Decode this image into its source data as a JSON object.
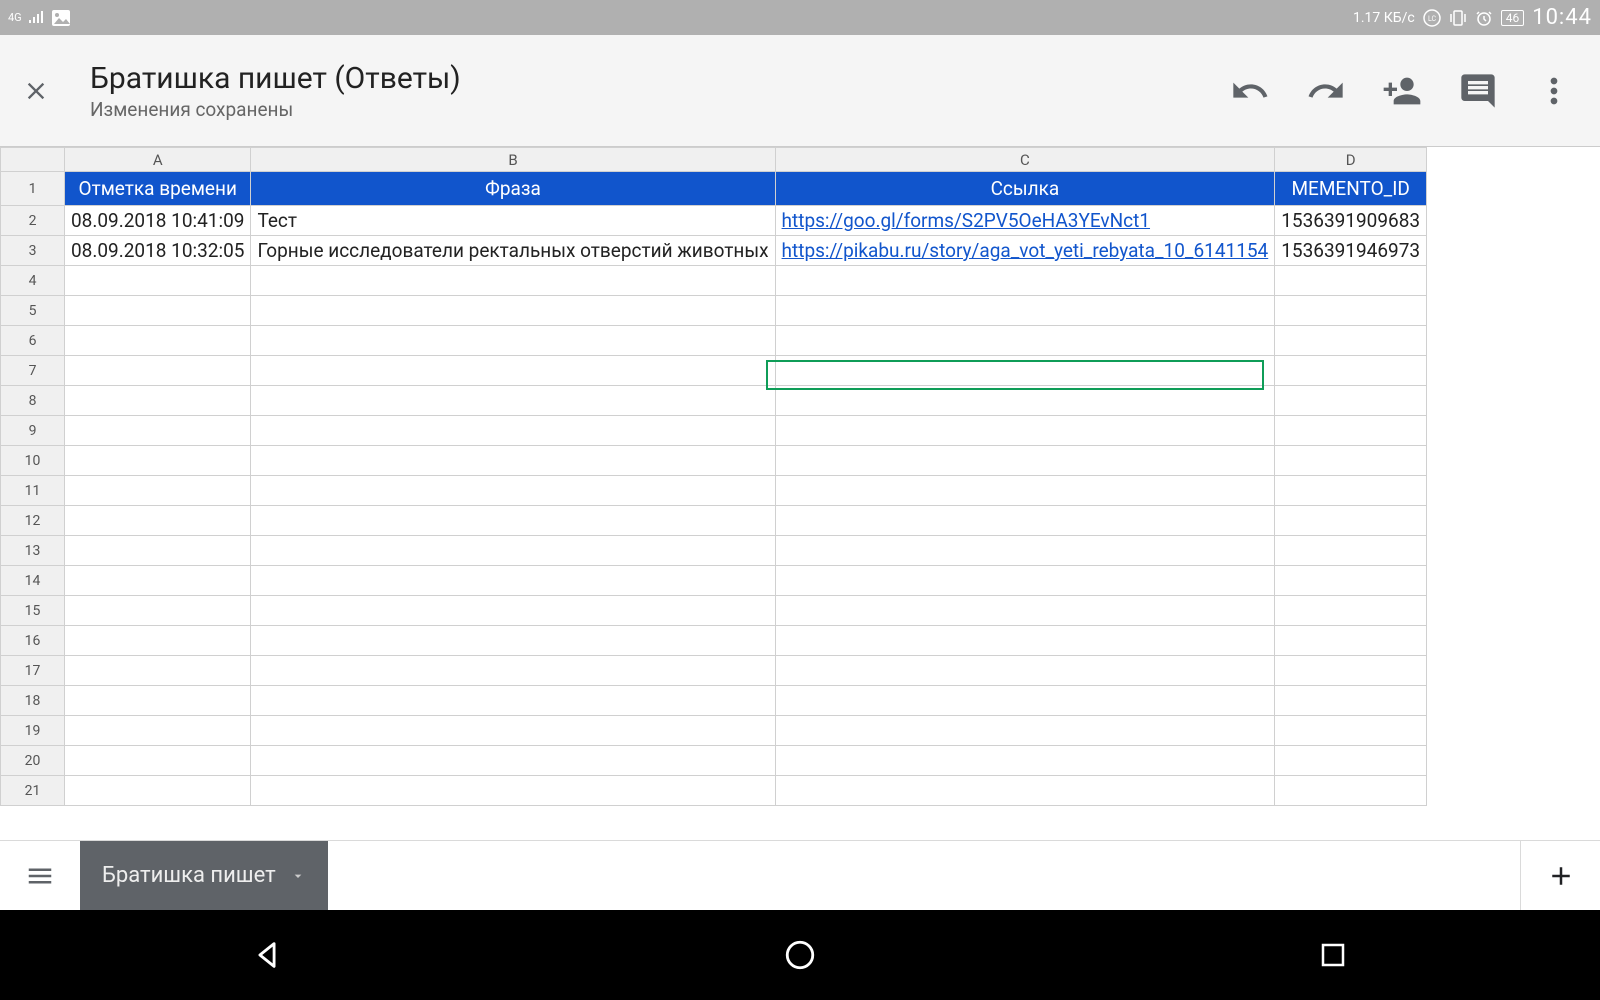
{
  "status": {
    "net_label": "4G",
    "data_rate": "1.17 КБ/с",
    "battery": "46",
    "clock": "10:44"
  },
  "header": {
    "title": "Братишка пишет (Ответы)",
    "subtitle": "Изменения сохранены"
  },
  "columns": {
    "letters": [
      "A",
      "B",
      "C",
      "D"
    ],
    "headers": [
      "Отметка времени",
      "Фраза",
      "Ссылка",
      "MEMENTO_ID"
    ]
  },
  "rows": [
    {
      "timestamp": "08.09.2018 10:41:09",
      "phrase": "Тест",
      "link": "https://goo.gl/forms/S2PV5OeHA3YEvNct1",
      "id": "1536391909683"
    },
    {
      "timestamp": "08.09.2018 10:32:05",
      "phrase": "Горные исследователи ректальных отверстий животных",
      "link": "https://pikabu.ru/story/aga_vot_yeti_rebyata_10_6141154",
      "id": "1536391946973"
    }
  ],
  "row_numbers": [
    "1",
    "2",
    "3",
    "4",
    "5",
    "6",
    "7",
    "8",
    "9",
    "10",
    "11",
    "12",
    "13",
    "14",
    "15",
    "16",
    "17",
    "18",
    "19",
    "20",
    "21"
  ],
  "selected_cell": {
    "row": 7,
    "col": "C"
  },
  "sheet_tab": {
    "name": "Братишка пишет"
  }
}
